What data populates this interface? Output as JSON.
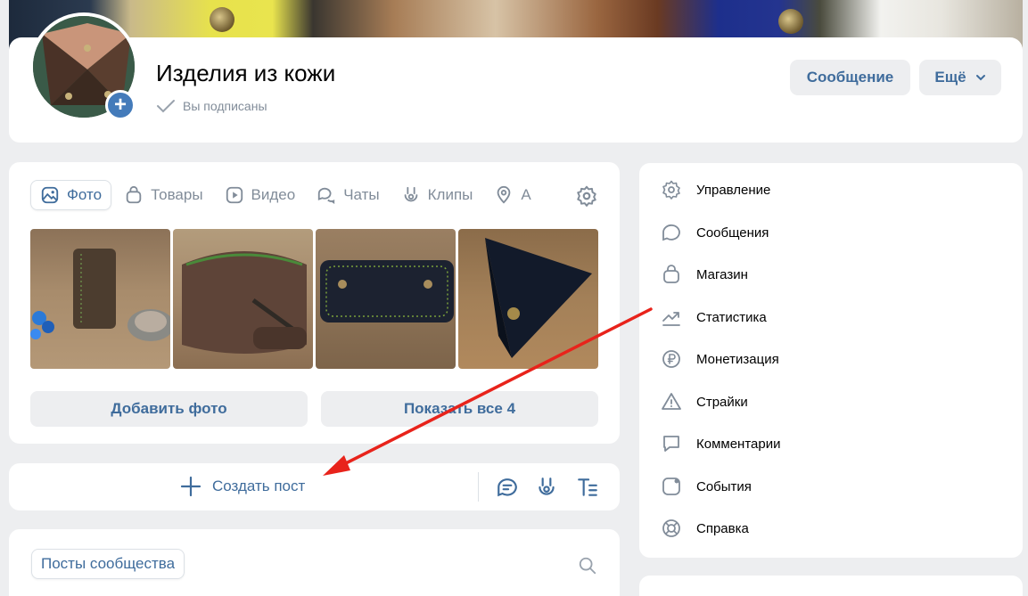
{
  "header": {
    "title": "Изделия из кожи",
    "status": "Вы подписаны",
    "message_button": "Сообщение",
    "more_button": "Ещё"
  },
  "media": {
    "tabs": [
      {
        "label": "Фото",
        "icon": "photo-icon",
        "active": true
      },
      {
        "label": "Товары",
        "icon": "bag-icon",
        "active": false
      },
      {
        "label": "Видео",
        "icon": "video-icon",
        "active": false
      },
      {
        "label": "Чаты",
        "icon": "chats-icon",
        "active": false
      },
      {
        "label": "Клипы",
        "icon": "clips-icon",
        "active": false
      },
      {
        "label": "А",
        "icon": "place-icon",
        "active": false
      }
    ],
    "add_photo_button": "Добавить фото",
    "show_all_button": "Показать все 4"
  },
  "post": {
    "create_label": "Создать пост"
  },
  "posts": {
    "tab_label": "Посты сообщества"
  },
  "menu": {
    "items": [
      {
        "label": "Управление",
        "icon": "gear-icon"
      },
      {
        "label": "Сообщения",
        "icon": "message-icon"
      },
      {
        "label": "Магазин",
        "icon": "shop-icon"
      },
      {
        "label": "Статистика",
        "icon": "stats-icon"
      },
      {
        "label": "Монетизация",
        "icon": "ruble-icon"
      },
      {
        "label": "Страйки",
        "icon": "warning-icon"
      },
      {
        "label": "Комментарии",
        "icon": "comment-icon"
      },
      {
        "label": "События",
        "icon": "event-icon"
      },
      {
        "label": "Справка",
        "icon": "help-icon"
      }
    ]
  },
  "colors": {
    "accent": "#3f6c9c",
    "avatar_add": "#447bba",
    "annotation_arrow": "#e8231b",
    "background": "#edeef0"
  }
}
